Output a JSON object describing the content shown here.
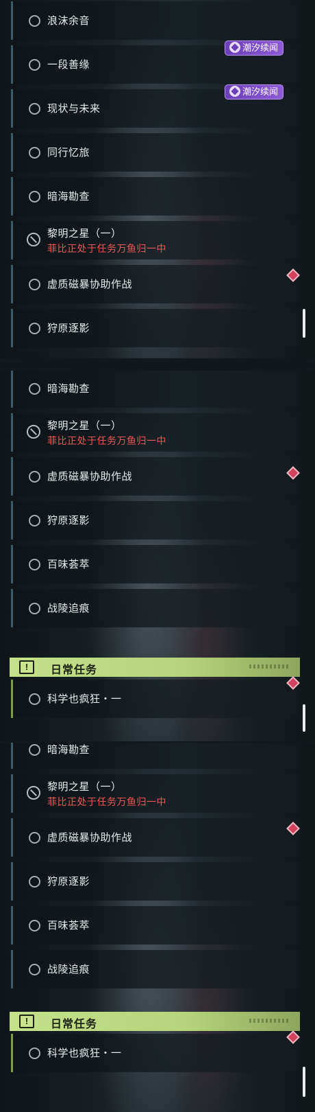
{
  "screens": [
    {
      "items": [
        {
          "label": "浪沫余音"
        },
        {
          "label": "一段善缘",
          "badge": "潮汐续闻"
        },
        {
          "label": "现状与未来",
          "badge": "潮汐续闻"
        },
        {
          "label": "同行忆旅"
        },
        {
          "label": "暗海勘查"
        },
        {
          "label": "黎明之星（一）",
          "sub": "菲比正处于任务万鱼归一中",
          "blocked": true
        },
        {
          "label": "虚质磁暴协助作战"
        },
        {
          "label": "狩原逐影"
        }
      ]
    },
    {
      "items": [
        {
          "label": "暗海勘查"
        },
        {
          "label": "黎明之星（一）",
          "sub": "菲比正处于任务万鱼归一中",
          "blocked": true
        },
        {
          "label": "虚质磁暴协助作战"
        },
        {
          "label": "狩原逐影"
        },
        {
          "label": "百味荟萃"
        },
        {
          "label": "战陵追痕"
        }
      ],
      "section": {
        "title": "日常任务",
        "icon": "exclamation-icon"
      },
      "daily": [
        {
          "label": "科学也疯狂・一"
        }
      ]
    },
    {
      "items": [
        {
          "label": "暗海勘查"
        },
        {
          "label": "黎明之星（一）",
          "sub": "菲比正处于任务万鱼归一中",
          "blocked": true
        },
        {
          "label": "虚质磁暴协助作战"
        },
        {
          "label": "狩原逐影"
        },
        {
          "label": "百味荟萃"
        },
        {
          "label": "战陵追痕"
        }
      ],
      "section": {
        "title": "日常任务",
        "icon": "exclamation-icon"
      },
      "daily": [
        {
          "label": "科学也疯狂・一"
        }
      ]
    }
  ],
  "colors": {
    "accent_red": "#ef5656",
    "badge_purple": "#7b4bc8",
    "section_green": "#b7d47d"
  }
}
